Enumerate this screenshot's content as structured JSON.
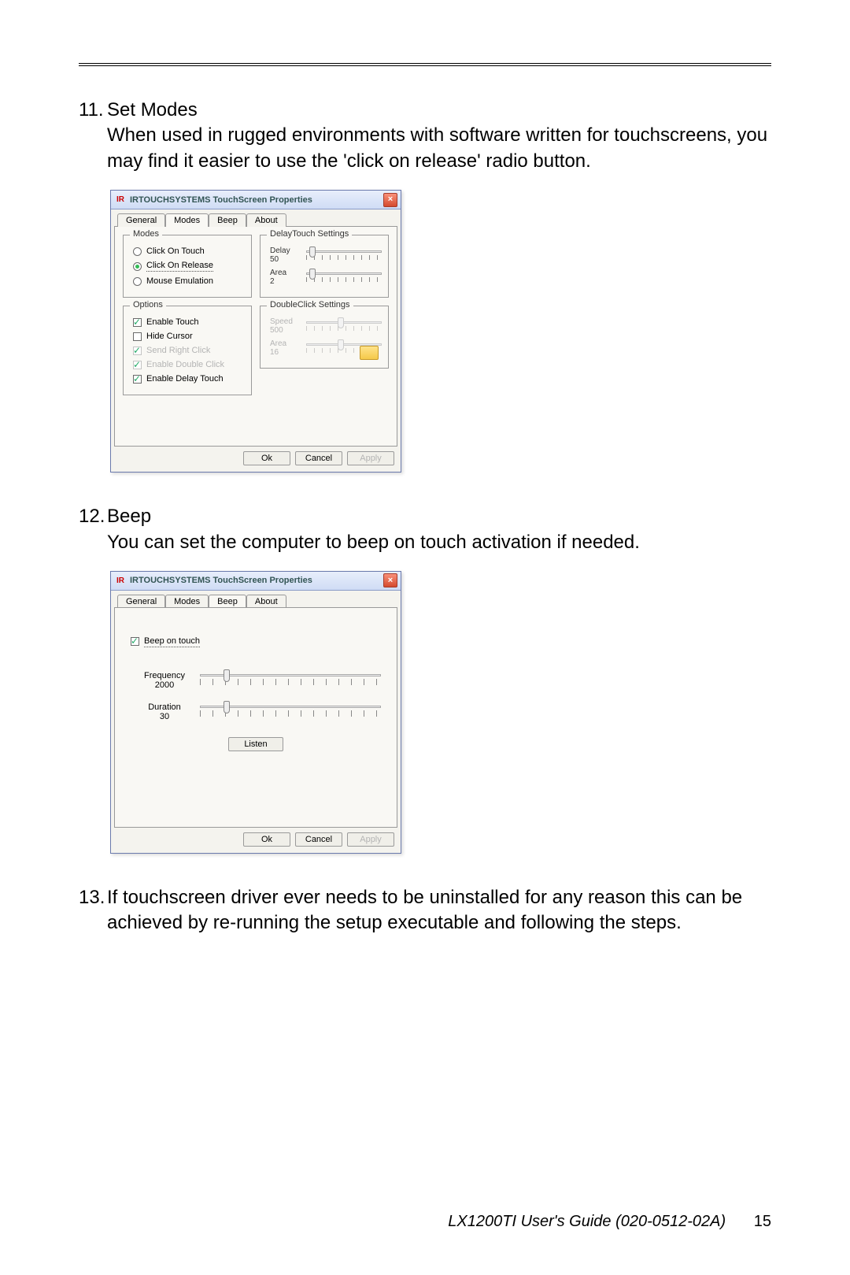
{
  "items": {
    "i11": {
      "num": "11.",
      "title": "Set Modes",
      "desc": "When used in rugged environments with software written for touchscreens, you may find it easier to use the 'click on release' radio button."
    },
    "i12": {
      "num": "12.",
      "title": "Beep",
      "desc": "You can set the computer to beep on touch activation if needed."
    },
    "i13": {
      "num": "13.",
      "desc": "If touchscreen driver ever needs to be uninstalled for any reason this can be achieved by re-running the setup executable and following the steps."
    }
  },
  "dialog": {
    "icon": "IR",
    "title": "IRTOUCHSYSTEMS TouchScreen Properties",
    "tabs": {
      "general": "General",
      "modes": "Modes",
      "beep": "Beep",
      "about": "About"
    },
    "buttons": {
      "ok": "Ok",
      "cancel": "Cancel",
      "apply": "Apply"
    }
  },
  "modes": {
    "group_modes_title": "Modes",
    "radio_touch": "Click On Touch",
    "radio_release": "Click On Release",
    "radio_mouse": "Mouse Emulation",
    "group_options_title": "Options",
    "chk_enable_touch": "Enable Touch",
    "chk_hide_cursor": "Hide Cursor",
    "chk_send_right": "Send Right Click",
    "chk_enable_dbl": "Enable Double Click",
    "chk_enable_delay": "Enable Delay Touch",
    "group_delay_title": "DelayTouch Settings",
    "delay_label": "Delay",
    "delay_val": "50",
    "area_label": "Area",
    "area_val": "2",
    "group_dbl_title": "DoubleClick Settings",
    "speed_label": "Speed",
    "speed_val": "500",
    "area2_label": "Area",
    "area2_val": "16"
  },
  "beep": {
    "chk_beep": "Beep on touch",
    "freq_label": "Frequency",
    "freq_val": "2000",
    "dur_label": "Duration",
    "dur_val": "30",
    "listen": "Listen"
  },
  "footer": {
    "guide": "LX1200TI User's Guide (020-0512-02A)",
    "page": "15"
  }
}
